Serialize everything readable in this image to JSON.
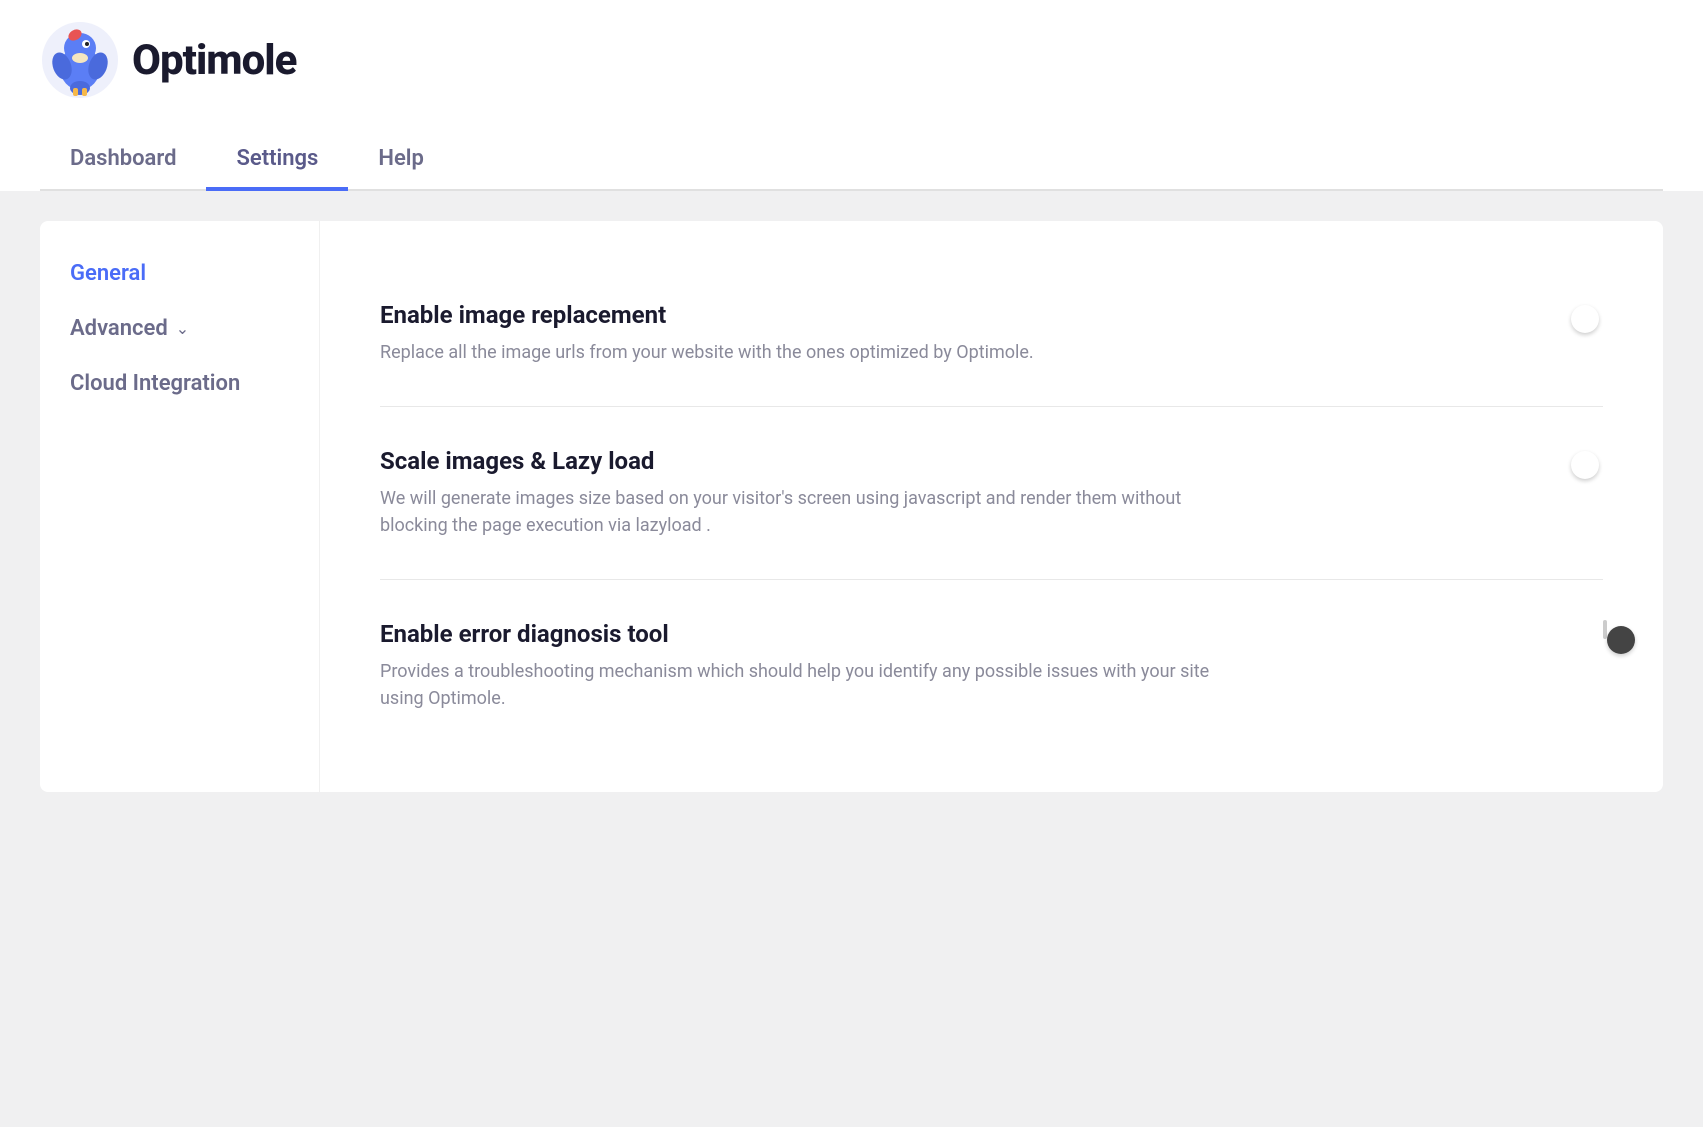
{
  "app": {
    "logo_text": "Optimole",
    "logo_bg": "#eef0fb"
  },
  "nav": {
    "tabs": [
      {
        "id": "dashboard",
        "label": "Dashboard",
        "active": false
      },
      {
        "id": "settings",
        "label": "Settings",
        "active": true
      },
      {
        "id": "help",
        "label": "Help",
        "active": false
      }
    ]
  },
  "sidebar": {
    "items": [
      {
        "id": "general",
        "label": "General",
        "active": true,
        "has_arrow": false
      },
      {
        "id": "advanced",
        "label": "Advanced",
        "active": false,
        "has_arrow": true
      },
      {
        "id": "cloud-integration",
        "label": "Cloud Integration",
        "active": false,
        "has_arrow": false
      }
    ]
  },
  "settings": [
    {
      "id": "image-replacement",
      "title": "Enable image replacement",
      "description": "Replace all the image urls from your website with the ones optimized by Optimole.",
      "enabled": true
    },
    {
      "id": "scale-lazy",
      "title": "Scale images & Lazy load",
      "description": "We will generate images size based on your visitor's screen using javascript and render them without blocking the page execution via lazyload .",
      "enabled": true
    },
    {
      "id": "error-diagnosis",
      "title": "Enable error diagnosis tool",
      "description": "Provides a troubleshooting mechanism which should help you identify any possible issues with your site using Optimole.",
      "enabled": false
    }
  ],
  "colors": {
    "primary": "#4a6cf7",
    "text_dark": "#1a1a2e",
    "text_muted": "#8a8a9a",
    "text_sidebar": "#6b6b8a",
    "active_sidebar": "#4a6cf7",
    "toggle_on": "#4a6cf7",
    "toggle_off_bg": "#e0e0e0",
    "border": "#e8e8e8",
    "bg_main": "#f0f0f1",
    "bg_white": "#ffffff"
  }
}
